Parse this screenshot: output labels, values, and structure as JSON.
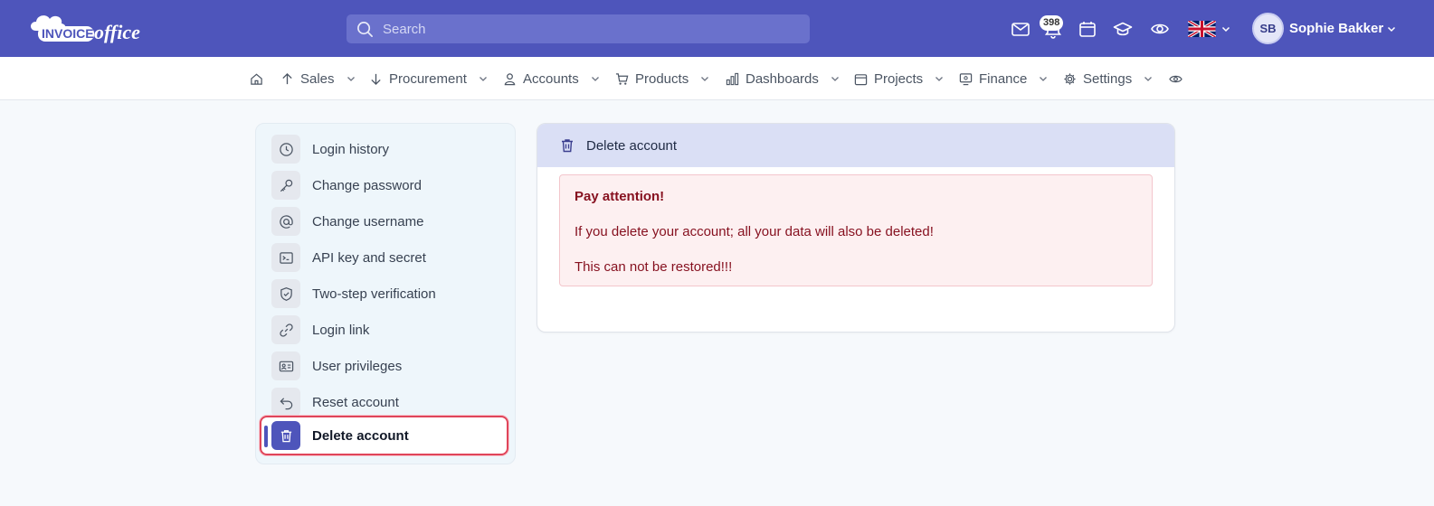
{
  "header": {
    "logo_text": "INVOICEoffice",
    "search_placeholder": "Search",
    "notifications_count": "398",
    "user_initials": "SB",
    "user_name": "Sophie Bakker"
  },
  "nav": {
    "items": [
      {
        "label": "Sales",
        "icon": "arrow-up-icon"
      },
      {
        "label": "Procurement",
        "icon": "arrow-down-icon"
      },
      {
        "label": "Accounts",
        "icon": "person-icon"
      },
      {
        "label": "Products",
        "icon": "cart-icon"
      },
      {
        "label": "Dashboards",
        "icon": "bar-chart-icon"
      },
      {
        "label": "Projects",
        "icon": "calendar-icon"
      },
      {
        "label": "Finance",
        "icon": "monitor-icon"
      },
      {
        "label": "Settings",
        "icon": "gear-icon"
      }
    ]
  },
  "sidebar": {
    "items": [
      {
        "label": "Login history",
        "icon": "clock-icon"
      },
      {
        "label": "Change password",
        "icon": "key-icon"
      },
      {
        "label": "Change username",
        "icon": "at-icon"
      },
      {
        "label": "API key and secret",
        "icon": "terminal-icon"
      },
      {
        "label": "Two-step verification",
        "icon": "shield-icon"
      },
      {
        "label": "Login link",
        "icon": "link-icon"
      },
      {
        "label": "User privileges",
        "icon": "id-card-icon"
      },
      {
        "label": "Reset account",
        "icon": "undo-icon"
      },
      {
        "label": "Delete account",
        "icon": "trash-icon",
        "active": true
      }
    ]
  },
  "main": {
    "card_title": "Delete account",
    "alert_title": "Pay attention!",
    "alert_line1": "If you delete your account; all your data will also be deleted!",
    "alert_line2": "This can not be restored!!!"
  },
  "colors": {
    "brand": "#4e55bb",
    "alert_bg": "#fdf0f1",
    "alert_text": "#86101f",
    "active_outline": "#e0455a"
  }
}
